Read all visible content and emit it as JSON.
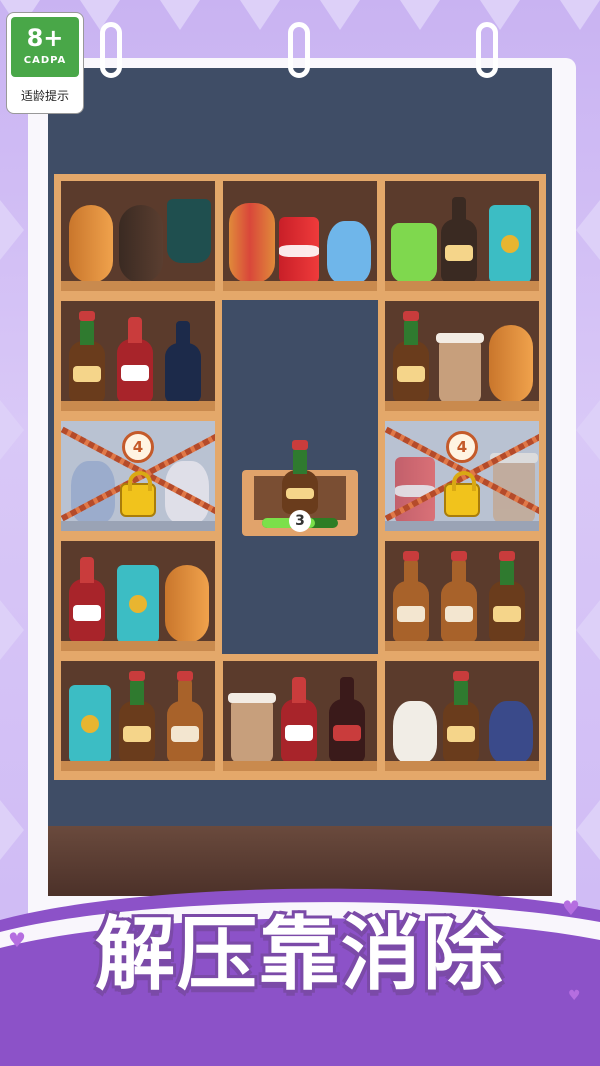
{
  "age_rating": {
    "age": "8+",
    "organization": "CADPA",
    "caption": "适龄提示"
  },
  "slogan": "解压靠消除",
  "locked_cells": [
    {
      "id": "left",
      "count": "4"
    },
    {
      "id": "right",
      "count": "4"
    }
  ],
  "tray": {
    "count": "3",
    "progress": 0.7
  },
  "colors": {
    "background": "#cdb8f4",
    "wall": "#3f4d66",
    "shelf_wood": "#e4a86a",
    "banner": "#8c52c8",
    "slogan_outline": "#7b4aa8"
  },
  "shelf_items": {
    "row1": [
      [
        "bread",
        "bread-dark",
        "popsicle"
      ],
      [
        "hotdog",
        "cola-can",
        "cat-plush"
      ],
      [
        "lime-drink",
        "beer-bottle",
        "teal-bag"
      ]
    ],
    "row2": [
      [
        "sauce-bottle",
        "cola-bottle",
        "navy-bottle"
      ],
      [],
      [
        "sauce-bottle",
        "coffee-cup",
        "bread"
      ]
    ],
    "row3": [
      [
        "penguin-plush",
        "sheep-plush"
      ],
      [],
      [
        "cola-can",
        "coffee-cup"
      ]
    ],
    "row4": [
      [
        "cola-bottle",
        "teal-bag",
        "bread"
      ],
      [],
      [
        "beer-bottle",
        "beer-bottle",
        "sauce-bottle"
      ]
    ],
    "row5": [
      [
        "teal-bag",
        "sauce-bottle",
        "beer-bottle"
      ],
      [
        "coffee-cup",
        "cola-bottle",
        "cola-bottle-dark"
      ],
      [
        "sheep-plush",
        "sauce-bottle",
        "penguin-plush"
      ]
    ]
  }
}
